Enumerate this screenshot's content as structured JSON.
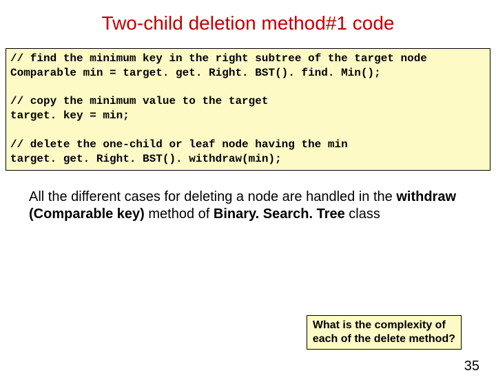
{
  "title": "Two-child deletion method#1 code",
  "code": "// find the minimum key in the right subtree of the target node\nComparable min = target. get. Right. BST(). find. Min();\n\n// copy the minimum value to the target\ntarget. key = min;\n\n// delete the one-child or leaf node having the min\ntarget. get. Right. BST(). withdraw(min);",
  "body": {
    "pre": "All the different cases for deleting a node  are handled in the ",
    "bold1": "withdraw (Comparable key)",
    "mid": " method of ",
    "bold2": "Binary. Search. Tree",
    "post": " class"
  },
  "callout": {
    "line1": "What is the complexity of",
    "line2": " each of the delete method?"
  },
  "pageNumber": "35"
}
